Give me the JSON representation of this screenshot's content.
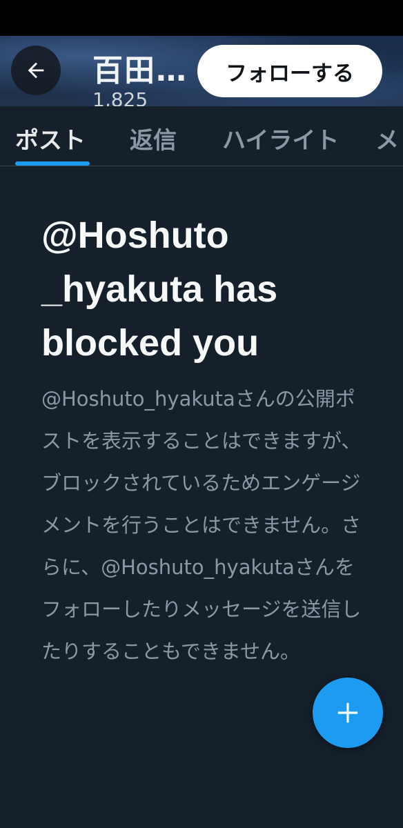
{
  "header": {
    "back_icon": "arrow-left-icon",
    "title": "百田…",
    "subtitle": "1,825",
    "follow_label": "フォローする"
  },
  "tabs": [
    {
      "label": "ポスト",
      "active": true
    },
    {
      "label": "返信",
      "active": false
    },
    {
      "label": "ハイライト",
      "active": false
    },
    {
      "label": "メ",
      "active": false
    }
  ],
  "blocked": {
    "heading": "@Hoshuto _hyakuta has blocked you",
    "description": "@Hoshuto_hyakutaさんの公開ポストを表示することはできますが、ブロックされているためエンゲージメントを行うことはできません。さらに、@Hoshuto_hyakutaさんをフォローしたりメッセージを送信したりすることもできません。"
  },
  "fab": {
    "icon": "plus-icon"
  },
  "colors": {
    "background": "#15202b",
    "accent": "#1d9bf0",
    "primary_text": "#e7e9ea",
    "secondary_text": "#8b98a5"
  }
}
